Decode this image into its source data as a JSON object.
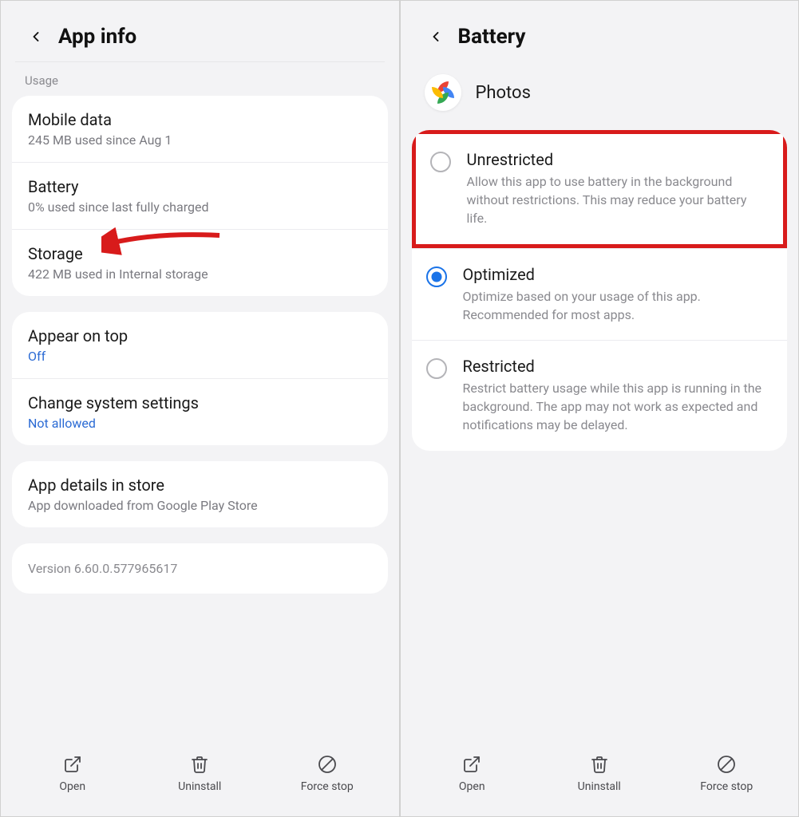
{
  "left": {
    "title": "App info",
    "section_label": "Usage",
    "usage": [
      {
        "title": "Mobile data",
        "sub": "245 MB used since Aug 1"
      },
      {
        "title": "Battery",
        "sub": "0% used since last fully charged"
      },
      {
        "title": "Storage",
        "sub": "422 MB used in Internal storage"
      }
    ],
    "permissions": [
      {
        "title": "Appear on top",
        "sub": "Off",
        "blue": true
      },
      {
        "title": "Change system settings",
        "sub": "Not allowed",
        "blue": true
      }
    ],
    "details": {
      "title": "App details in store",
      "sub": "App downloaded from Google Play Store"
    },
    "version": "Version 6.60.0.577965617"
  },
  "right": {
    "title": "Battery",
    "app_name": "Photos",
    "options": [
      {
        "title": "Unrestricted",
        "desc": "Allow this app to use battery in the background without restrictions. This may reduce your battery life.",
        "selected": false,
        "highlight": true
      },
      {
        "title": "Optimized",
        "desc": "Optimize based on your usage of this app. Recommended for most apps.",
        "selected": true,
        "highlight": false
      },
      {
        "title": "Restricted",
        "desc": "Restrict battery usage while this app is running in the background. The app may not work as expected and notifications may be delayed.",
        "selected": false,
        "highlight": false
      }
    ]
  },
  "bottom": {
    "open": "Open",
    "uninstall": "Uninstall",
    "force_stop": "Force stop"
  }
}
